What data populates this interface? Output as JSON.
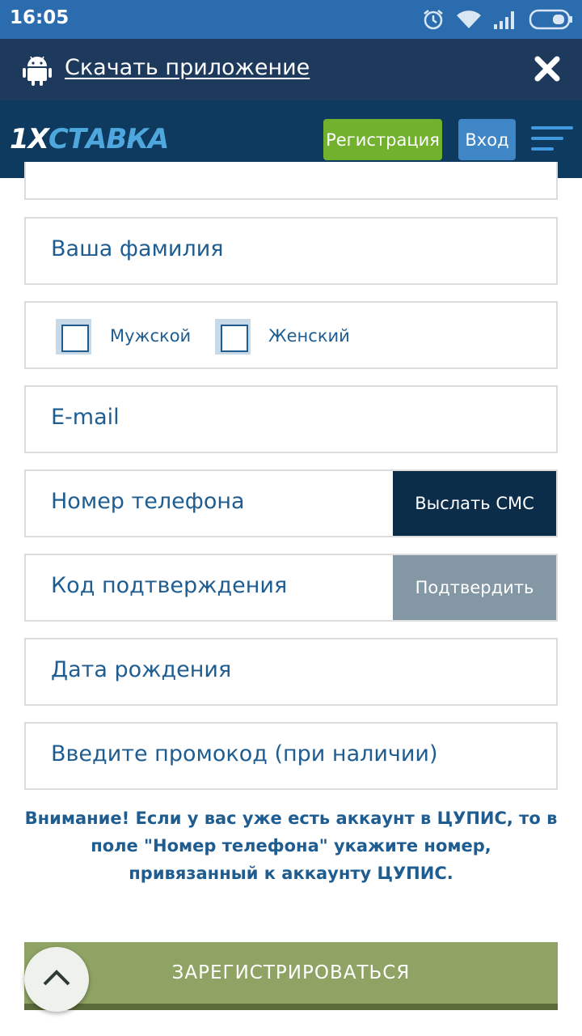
{
  "status_bar": {
    "time": "16:05",
    "icons": [
      "alarm-icon",
      "wifi-icon",
      "signal-icon",
      "battery-icon"
    ]
  },
  "banner": {
    "icon": "android-icon",
    "link_text": "Скачать приложение",
    "close_icon": "close-icon"
  },
  "header": {
    "logo_part1": "1X",
    "logo_part2": "СТАВКА",
    "register_label": "Регистрация",
    "login_label": "Вход",
    "menu_icon": "hamburger-menu-icon"
  },
  "form": {
    "surname_placeholder": "Ваша фамилия",
    "gender": {
      "male_label": "Мужской",
      "female_label": "Женский"
    },
    "email_placeholder": "E-mail",
    "phone_placeholder": "Номер телефона",
    "send_sms_label": "Выслать СМС",
    "code_placeholder": "Код подтверждения",
    "confirm_label": "Подтвердить",
    "birthdate_placeholder": "Дата рождения",
    "promo_placeholder": "Введите промокод (при наличии)"
  },
  "notice": "Внимание! Если у вас уже есть аккаунт в ЦУПИС, то в поле \"Номер телефона\" укажите номер, привязанный к аккаунту ЦУПИС.",
  "submit_label": "ЗАРЕГИСТРИРОВАТЬСЯ",
  "colors": {
    "header_bg": "#0f3a5f",
    "register_green": "#72b12e",
    "login_blue": "#3f86c6",
    "text_blue": "#1f5d91",
    "submit_green": "#8fa464"
  }
}
